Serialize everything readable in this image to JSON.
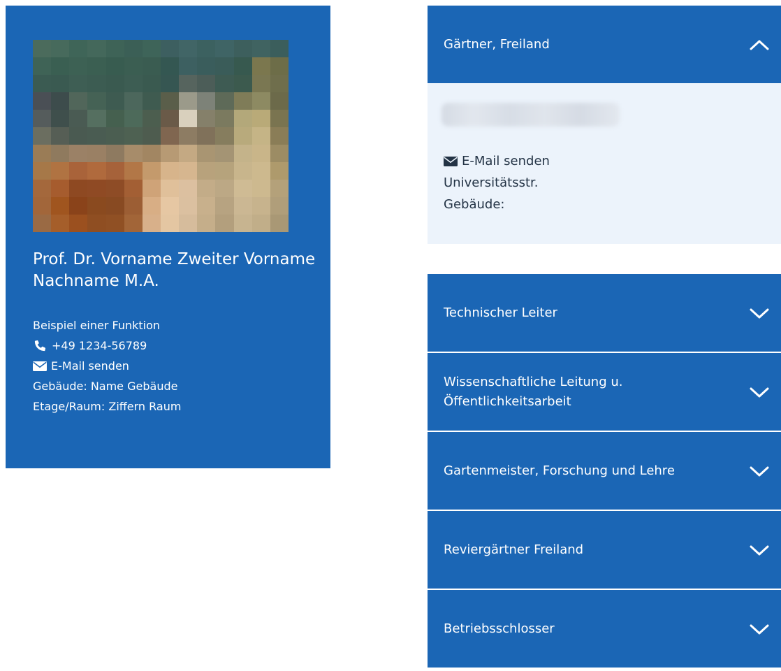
{
  "profile": {
    "name": "Prof. Dr. Vorname Zweiter Vorname Nachname M.A.",
    "function": "Beispiel einer Funktion",
    "phone": "+49 1234-56789",
    "email_label": "E-Mail senden",
    "building": "Gebäude: Name Gebäude",
    "room": "Etage/Raum: Ziffern Raum",
    "icons": {
      "phone": "phone-icon",
      "email": "envelope-icon"
    }
  },
  "accordion": {
    "open_section": {
      "title": "Gärtner, Freiland",
      "email_label": "E-Mail senden",
      "street": "Universitätsstr.",
      "building": "Gebäude:"
    },
    "sections": [
      {
        "title": "Technischer Leiter"
      },
      {
        "title": "Wissenschaftliche Leitung u. Öffentlichkeitsarbeit"
      },
      {
        "title": "Gartenmeister, Forschung und Lehre"
      },
      {
        "title": "Reviergärtner Freiland"
      },
      {
        "title": "Betriebsschlosser"
      }
    ]
  },
  "colors": {
    "primary": "#1b66b5",
    "panel_background": "#ecf3fb",
    "text_dark": "#233345",
    "text_light": "#ffffff"
  }
}
